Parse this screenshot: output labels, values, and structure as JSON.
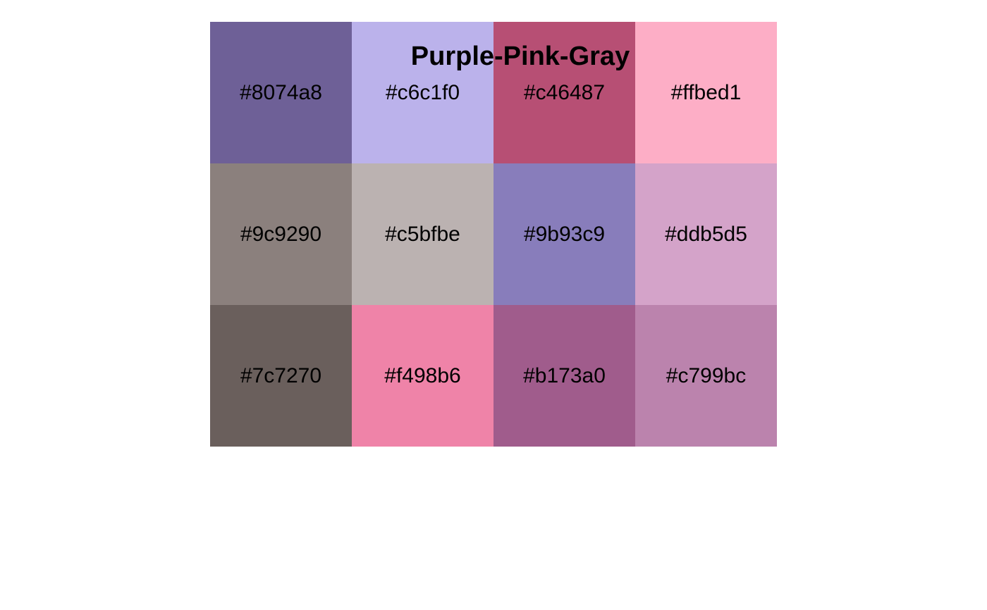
{
  "palette": {
    "title": "Purple-Pink-Gray",
    "swatches": [
      {
        "label": "#8074a8",
        "fill": "#6e6097"
      },
      {
        "label": "#c6c1f0",
        "fill": "#bbb2eb"
      },
      {
        "label": "#c46487",
        "fill": "#b74f74"
      },
      {
        "label": "#ffbed1",
        "fill": "#fdaec6"
      },
      {
        "label": "#9c9290",
        "fill": "#8b807d"
      },
      {
        "label": "#c5bfbe",
        "fill": "#bbb2b1"
      },
      {
        "label": "#9b93c9",
        "fill": "#887dbb"
      },
      {
        "label": "#ddb5d5",
        "fill": "#d4a3c9"
      },
      {
        "label": "#7c7270",
        "fill": "#6a5f5c"
      },
      {
        "label": "#f498b6",
        "fill": "#ef83a8"
      },
      {
        "label": "#b173a0",
        "fill": "#a05c8c"
      },
      {
        "label": "#c799bc",
        "fill": "#bb83ad"
      }
    ]
  }
}
